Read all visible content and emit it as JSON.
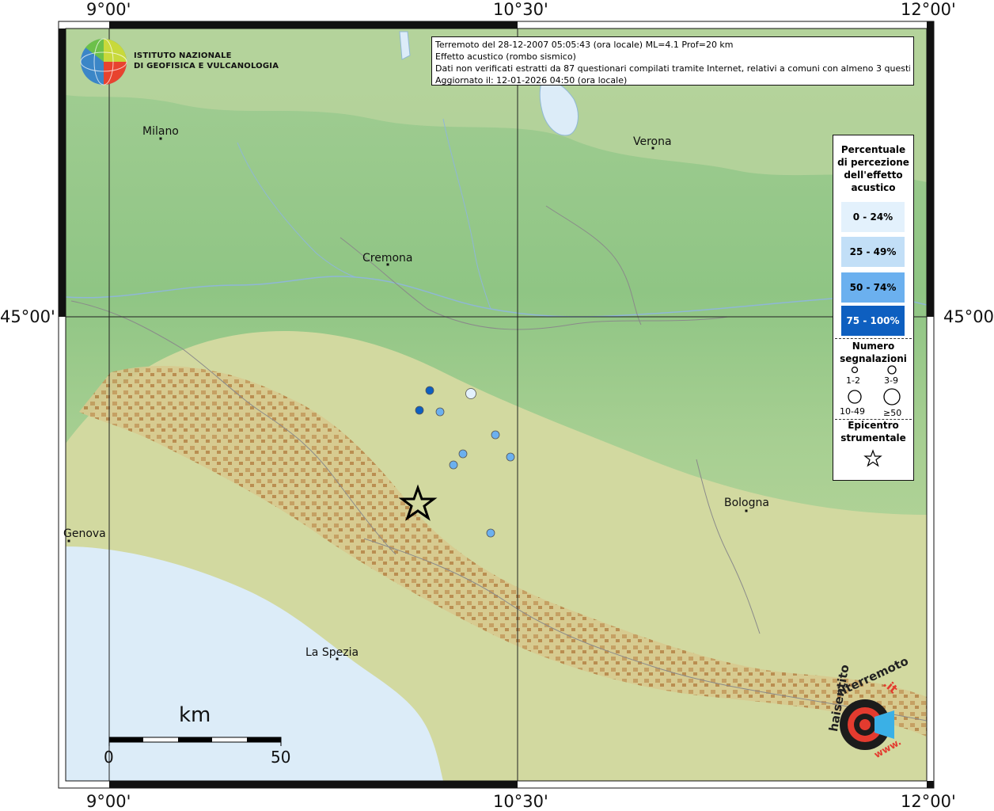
{
  "coords": {
    "top": [
      "9°00'",
      "10°30'",
      "12°00'"
    ],
    "bottom": [
      "9°00'",
      "10°30'",
      "12°00'"
    ],
    "left": "45°00'",
    "right": "45°00'"
  },
  "logo": {
    "line1": "ISTITUTO NAZIONALE",
    "line2": "DI GEOFISICA E VULCANOLOGIA"
  },
  "info": {
    "line1": "Terremoto del 28-12-2007 05:05:43 (ora locale) ML=4.1 Prof=20 km",
    "line2": "Effetto acustico (rombo sismico)",
    "line3": "Dati non verificati estratti da 87 questionari compilati tramite Internet, relativi a comuni con almeno 3 questionari.",
    "line4": "Aggiornato il: 12-01-2026 04:50 (ora locale)"
  },
  "cities": [
    {
      "name": "Milano"
    },
    {
      "name": "Verona"
    },
    {
      "name": "Cremona"
    },
    {
      "name": "Bologna"
    },
    {
      "name": "Genova"
    },
    {
      "name": "La Spezia"
    }
  ],
  "legend": {
    "title_lines": [
      "Percentuale",
      "di percezione",
      "dell'effetto",
      "acustico"
    ],
    "percent_classes": [
      {
        "label": "0 - 24%",
        "color": "#e3f1fc"
      },
      {
        "label": "25 - 49%",
        "color": "#c2dff7"
      },
      {
        "label": "50 - 74%",
        "color": "#6bb0ef"
      },
      {
        "label": "75 - 100%",
        "color": "#0e5fc0"
      }
    ],
    "count_title_lines": [
      "Numero",
      "segnalazioni"
    ],
    "count_classes": [
      "1-2",
      "3-9",
      "10-49",
      "≥50"
    ],
    "epicenter_title_lines": [
      "Epicentro",
      "strumentale"
    ]
  },
  "scale_bar": {
    "unit": "km",
    "start": "0",
    "end": "50"
  },
  "watermark": {
    "text_left": "haisentito",
    "text_mid": "ilterremoto",
    "text_right": ".it",
    "text_bottom": "www."
  },
  "observations": [
    {
      "class": 3,
      "size": "1-2"
    },
    {
      "class": 0,
      "size": "3-9"
    },
    {
      "class": 3,
      "size": "1-2"
    },
    {
      "class": 2,
      "size": "1-2"
    },
    {
      "class": 2,
      "size": "1-2"
    },
    {
      "class": 2,
      "size": "1-2"
    },
    {
      "class": 2,
      "size": "1-2"
    },
    {
      "class": 2,
      "size": "1-2"
    },
    {
      "class": 2,
      "size": "1-2"
    }
  ],
  "colors": {
    "plain": "#9cc98a",
    "hills": "#c8d8a0",
    "mountains": "#b98a4a",
    "sea": "#dcecf8",
    "border_line": "#888888",
    "river": "#8fb7d6"
  }
}
